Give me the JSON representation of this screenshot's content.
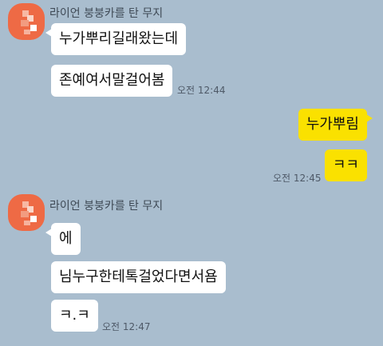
{
  "colors": {
    "background": "#a9bdce",
    "incoming_bubble": "#ffffff",
    "outgoing_bubble": "#fae100",
    "avatar": "#ee6a45"
  },
  "groups": [
    {
      "sender": "라이언 붕붕카를 탄 무지",
      "messages": [
        {
          "text": "누가뿌리길래왔는데"
        },
        {
          "text": "존예여서말걸어봄",
          "time": "오전 12:44"
        }
      ]
    },
    {
      "sender": "me",
      "messages": [
        {
          "text": "누가뿌림"
        },
        {
          "text": "ㅋㅋ",
          "time": "오전 12:45"
        }
      ]
    },
    {
      "sender": "라이언 붕붕카를 탄 무지",
      "messages": [
        {
          "text": "에"
        },
        {
          "text": "님누구한테톡걸었다면서욤"
        },
        {
          "text": "ㅋ.ㅋ",
          "time": "오전 12:47"
        }
      ]
    }
  ]
}
